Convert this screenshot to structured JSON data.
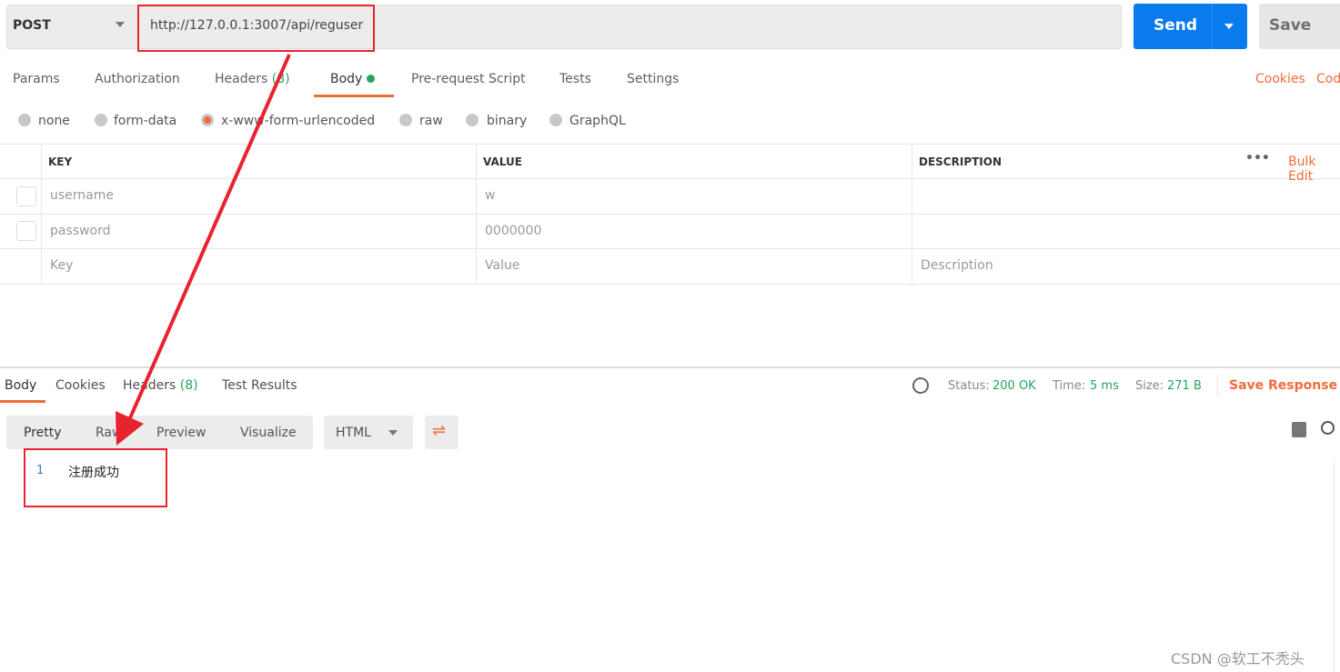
{
  "request": {
    "method": "POST",
    "url": "http://127.0.0.1:3007/api/reguser",
    "send_label": "Send",
    "save_label": "Save"
  },
  "tabs": [
    {
      "label": "Params"
    },
    {
      "label": "Authorization"
    },
    {
      "label": "Headers",
      "count": "(8)"
    },
    {
      "label": "Body"
    },
    {
      "label": "Pre-request Script"
    },
    {
      "label": "Tests"
    },
    {
      "label": "Settings"
    }
  ],
  "right_links": {
    "cookies": "Cookies",
    "code": "Code"
  },
  "body_types": [
    "none",
    "form-data",
    "x-www-form-urlencoded",
    "raw",
    "binary",
    "GraphQL"
  ],
  "selected_body_type": "x-www-form-urlencoded",
  "table": {
    "headers": {
      "key": "KEY",
      "value": "VALUE",
      "description": "DESCRIPTION"
    },
    "bulk_edit": "Bulk Edit",
    "rows": [
      {
        "key": "username",
        "value": "w"
      },
      {
        "key": "password",
        "value": "0000000"
      }
    ],
    "placeholders": {
      "key": "Key",
      "value": "Value",
      "description": "Description"
    }
  },
  "response": {
    "tabs": [
      "Body",
      "Cookies",
      "Headers",
      "Test Results"
    ],
    "headers_count": "(8)",
    "status_label": "Status:",
    "status": "200 OK",
    "time_label": "Time:",
    "time": "5 ms",
    "size_label": "Size:",
    "size": "271 B",
    "save_response": "Save Response",
    "views": [
      "Pretty",
      "Raw",
      "Preview",
      "Visualize"
    ],
    "format": "HTML",
    "lines": [
      {
        "num": "1",
        "text": "注册成功"
      }
    ]
  },
  "watermark": "CSDN @软工不秃头",
  "colors": {
    "accent": "#f26b3a",
    "send": "#097bed",
    "success": "#26a45c",
    "annotation": "#e8232e"
  }
}
